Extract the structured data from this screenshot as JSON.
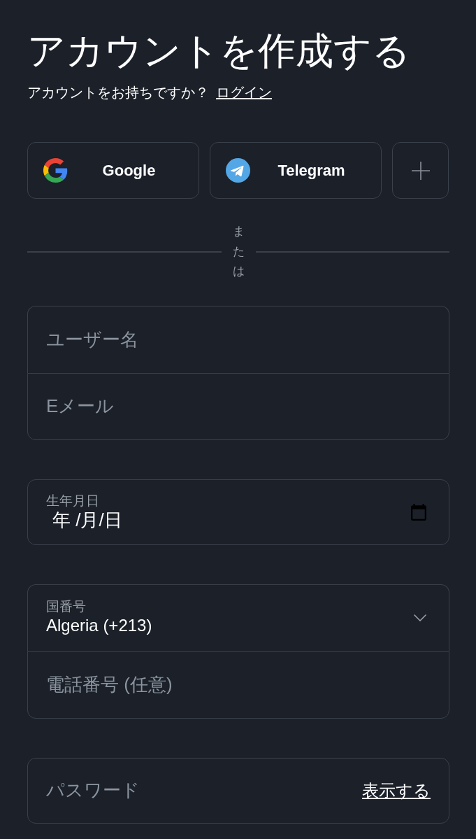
{
  "header": {
    "title": "アカウントを作成する",
    "prompt": "アカウントをお持ちですか？",
    "login_link": "ログイン"
  },
  "social_buttons": [
    {
      "kind": "google",
      "label": "Google"
    },
    {
      "kind": "telegram",
      "label": "Telegram"
    },
    {
      "kind": "more"
    }
  ],
  "divider": {
    "label": "または"
  },
  "field_groups": [
    {
      "fields": [
        {
          "kind": "text",
          "placeholder": "ユーザー名"
        },
        {
          "kind": "text",
          "placeholder": "Eメール"
        }
      ]
    },
    {
      "fields": [
        {
          "kind": "date",
          "label": "生年月日",
          "value": "年 /月/日"
        }
      ]
    },
    {
      "fields": [
        {
          "kind": "select",
          "label": "国番号",
          "value": "Algeria (+213)"
        },
        {
          "kind": "text",
          "placeholder": "電話番号 (任意)"
        }
      ]
    },
    {
      "fields": [
        {
          "kind": "password",
          "placeholder": "パスワード",
          "toggle": "表示する"
        }
      ]
    }
  ]
}
